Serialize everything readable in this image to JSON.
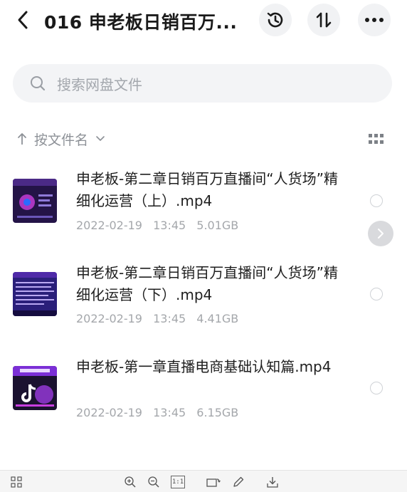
{
  "header": {
    "title": "016 申老板日销百万...",
    "back_icon": "chevron-left-icon",
    "history_icon": "clock-history-icon",
    "sort_icon": "sort-arrows-icon",
    "more_icon": "more-dots-icon"
  },
  "search": {
    "placeholder": "搜索网盘文件",
    "icon": "search-icon"
  },
  "sort": {
    "label": "按文件名",
    "direction_icon": "arrow-up-icon",
    "dropdown_icon": "chevron-down-icon",
    "view_icon": "grid-view-icon"
  },
  "files": [
    {
      "name": "申老板-第二章日销百万直播间“人货场”精细化运营（上）.mp4",
      "date": "2022-02-19",
      "time": "13:45",
      "size": "5.01GB"
    },
    {
      "name": "申老板-第二章日销百万直播间“人货场”精细化运营（下）.mp4",
      "date": "2022-02-19",
      "time": "13:45",
      "size": "4.41GB"
    },
    {
      "name": "申老板-第一章直播电商基础认知篇.mp4",
      "date": "2022-02-19",
      "time": "13:45",
      "size": "6.15GB"
    }
  ],
  "bottombar": {
    "actual_size_label": "1:1"
  },
  "colors": {
    "text_primary": "#1f1f1f",
    "text_secondary": "#a4a7ab",
    "search_bg": "#f3f4f6",
    "circle_btn_bg": "#f1f2f4"
  }
}
